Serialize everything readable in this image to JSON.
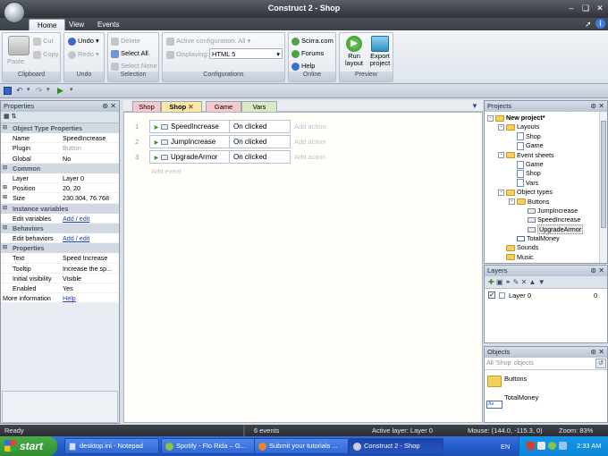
{
  "window": {
    "title": "Construct 2 - Shop"
  },
  "ribbon_tabs": [
    "Home",
    "View",
    "Events"
  ],
  "ribbon": {
    "clipboard": {
      "label": "Clipboard",
      "paste": "Paste",
      "cut": "Cut",
      "copy": "Copy"
    },
    "undo": {
      "label": "Undo",
      "undo": "Undo",
      "redo": "Redo"
    },
    "selection": {
      "label": "Selection",
      "delete": "Delete",
      "select_all": "Select All",
      "select_none": "Select None"
    },
    "configurations": {
      "label": "Configurations",
      "active": "Active configuration: All",
      "displaying_label": "Displaying:",
      "displaying_value": "HTML 5"
    },
    "online": {
      "label": "Online",
      "scirra": "Scirra.com",
      "forums": "Forums",
      "help": "Help"
    },
    "preview": {
      "label": "Preview",
      "run": "Run layout",
      "export": "Export project"
    }
  },
  "properties": {
    "title": "Properties",
    "rows": [
      {
        "cat": "Object Type Properties"
      },
      {
        "k": "Name",
        "v": "SpeedIncrease"
      },
      {
        "k": "Plugin",
        "v": "Button",
        "dim": true
      },
      {
        "k": "Global",
        "v": "No"
      },
      {
        "cat": "Common"
      },
      {
        "k": "Layer",
        "v": "Layer 0"
      },
      {
        "k": "Position",
        "v": "20, 20",
        "exp": true
      },
      {
        "k": "Size",
        "v": "230.304, 76.768",
        "exp": true
      },
      {
        "cat": "Instance variables"
      },
      {
        "k": "Edit variables",
        "v": "Add / edit",
        "link": true
      },
      {
        "cat": "Behaviors"
      },
      {
        "k": "Edit behaviors",
        "v": "Add / edit",
        "link": true
      },
      {
        "cat": "Properties"
      },
      {
        "k": "Text",
        "v": "Speed Increase"
      },
      {
        "k": "Tooltip",
        "v": "Increase the sp..."
      },
      {
        "k": "Initial visibility",
        "v": "Visible"
      },
      {
        "k": "Enabled",
        "v": "Yes"
      },
      {
        "k": "More information",
        "v": "Help",
        "link": true,
        "flush": true
      }
    ]
  },
  "sheet_tabs": [
    "Shop",
    "Shop",
    "Game",
    "Vars"
  ],
  "events": [
    {
      "num": "1",
      "obj": "SpeedIncrease",
      "cond": "On clicked",
      "add": "Add action"
    },
    {
      "num": "2",
      "obj": "JumpIncrease",
      "cond": "On clicked",
      "add": "Add action"
    },
    {
      "num": "3",
      "obj": "UpgradeArmor",
      "cond": "On clicked",
      "add": "Add action"
    }
  ],
  "add_event": "Add event",
  "projects": {
    "title": "Projects",
    "tree": [
      {
        "t": "New project*",
        "lvl": 0,
        "ic": "fold",
        "bold": true,
        "exp": "-"
      },
      {
        "t": "Layouts",
        "lvl": 1,
        "ic": "fold",
        "exp": "-"
      },
      {
        "t": "Shop",
        "lvl": 2,
        "ic": "pg"
      },
      {
        "t": "Game",
        "lvl": 2,
        "ic": "pg"
      },
      {
        "t": "Event sheets",
        "lvl": 1,
        "ic": "fold",
        "exp": "-"
      },
      {
        "t": "Game",
        "lvl": 2,
        "ic": "pg"
      },
      {
        "t": "Shop",
        "lvl": 2,
        "ic": "pg"
      },
      {
        "t": "Vars",
        "lvl": 2,
        "ic": "pg"
      },
      {
        "t": "Object types",
        "lvl": 1,
        "ic": "fold",
        "exp": "-"
      },
      {
        "t": "Buttons",
        "lvl": 2,
        "ic": "fold",
        "exp": "-"
      },
      {
        "t": "JumpIncrease",
        "lvl": 3,
        "ic": "btn"
      },
      {
        "t": "SpeedIncrease",
        "lvl": 3,
        "ic": "btn"
      },
      {
        "t": "UpgradeArmor",
        "lvl": 3,
        "ic": "btn",
        "sel": true
      },
      {
        "t": "TotalMoney",
        "lvl": 2,
        "ic": "txt"
      },
      {
        "t": "Sounds",
        "lvl": 1,
        "ic": "fold"
      },
      {
        "t": "Music",
        "lvl": 1,
        "ic": "fold"
      }
    ]
  },
  "layers": {
    "title": "Layers",
    "rows": [
      {
        "name": "Layer 0",
        "index": "0"
      }
    ]
  },
  "objects": {
    "title": "Objects",
    "filter": "All 'Shop' objects",
    "items": [
      "Buttons",
      "TotalMoney"
    ]
  },
  "status": {
    "ready": "Ready",
    "events": "6 events",
    "layer": "Active layer: Layer 0",
    "mouse": "Mouse: (144.0, -115.3, 0)",
    "zoom": "Zoom: 83%"
  },
  "taskbar": {
    "start": "start",
    "tasks": [
      "desktop.ini - Notepad",
      "Spotify - Flo Rida – G...",
      "Submit your tutorials ...",
      "Construct 2 - Shop"
    ],
    "lang": "EN",
    "clock": "2:33 AM"
  },
  "colors": {
    "sheet_tab_active": "#f9e8a6",
    "sheet_tab_pink": "#f7c9cf",
    "sheet_tab_green": "#d7ecc2",
    "link": "#1d3fb8"
  }
}
